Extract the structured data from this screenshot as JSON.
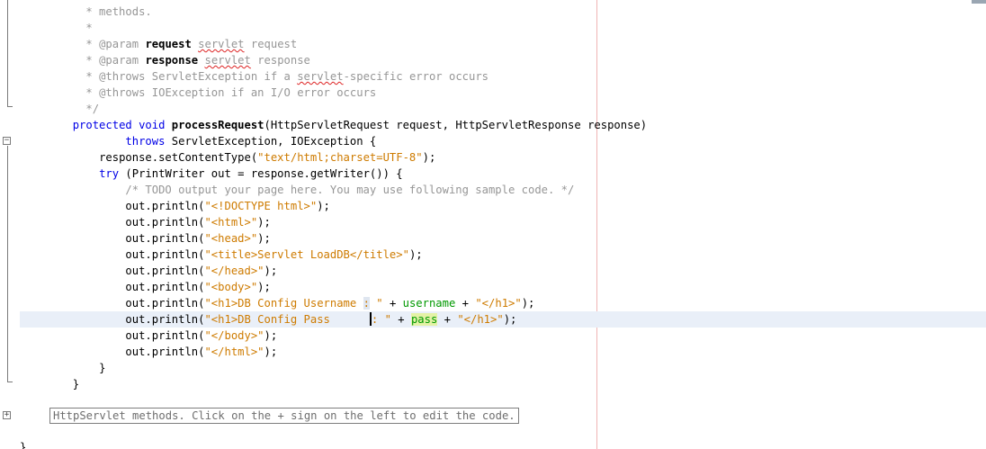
{
  "editor": {
    "lines": [
      {
        "indent": "    ",
        "text": "* methods."
      },
      {
        "indent": "    ",
        "text": "*"
      },
      {
        "indent": "    ",
        "text": "* "
      },
      {
        "indent": "    ",
        "text": "* "
      },
      {
        "indent": "    ",
        "text": "* "
      },
      {
        "indent": "    ",
        "text": "* "
      },
      {
        "indent": "    ",
        "text": "*/"
      }
    ],
    "javadoc": {
      "param1_tag": "@param",
      "param1_name": "request",
      "param1_word": "servlet",
      "param1_rest": " request",
      "param2_tag": "@param",
      "param2_name": "response",
      "param2_word": "servlet",
      "param2_rest": " response",
      "throws1_tag": "@throws",
      "throws1_a": " ServletException if a ",
      "throws1_word": "servlet",
      "throws1_b": "-specific error occurs",
      "throws2_tag": "@throws",
      "throws2_rest": " IOException if an I/O error occurs"
    },
    "signature": {
      "kw_protected": "protected",
      "kw_void": "void",
      "method_name": "processRequest",
      "params": "(HttpServletRequest request, HttpServletResponse response)",
      "kw_throws": "throws",
      "exceptions": " ServletException, IOException {"
    },
    "body": {
      "set_content_a": "response.setContentType(",
      "set_content_str": "\"text/html;charset=UTF-8\"",
      "set_content_b": ");",
      "kw_try": "try",
      "try_rest": " (PrintWriter out = response.getWriter()) {",
      "todo_comment": "/* TODO output your page here. You may use following sample code. */",
      "println_prefix": "out.println(",
      "println_suffix": ");",
      "str_doctype": "\"<!DOCTYPE html>\"",
      "str_html": "\"<html>\"",
      "str_head": "\"<head>\"",
      "str_title": "\"<title>Servlet LoadDB</title>\"",
      "str_head_close": "\"</head>\"",
      "str_body": "\"<body>\"",
      "str_h1_user_a": "\"<h1>DB Config Username ",
      "str_h1_user_colon": ":",
      "str_h1_user_b": " \"",
      "plus": " + ",
      "field_username": "username",
      "str_h1_close": "\"</h1>\"",
      "str_h1_pass_a": "\"<h1>DB Config Pass      ",
      "str_h1_pass_b": ": \"",
      "field_pass": "pass",
      "str_body_close": "\"</body>\"",
      "str_html_close": "\"</html>\"",
      "brace_inner": "}",
      "brace_outer": "}"
    },
    "fold_summary": "HttpServlet methods. Click on the + sign on the left to edit the code.",
    "final_brace": "}"
  },
  "colors": {
    "keyword": "#0000e6",
    "string": "#ce7b00",
    "comment": "#969696",
    "field": "#009900",
    "current_line": "#e9eff8",
    "margin_line": "#f0b4b4"
  }
}
